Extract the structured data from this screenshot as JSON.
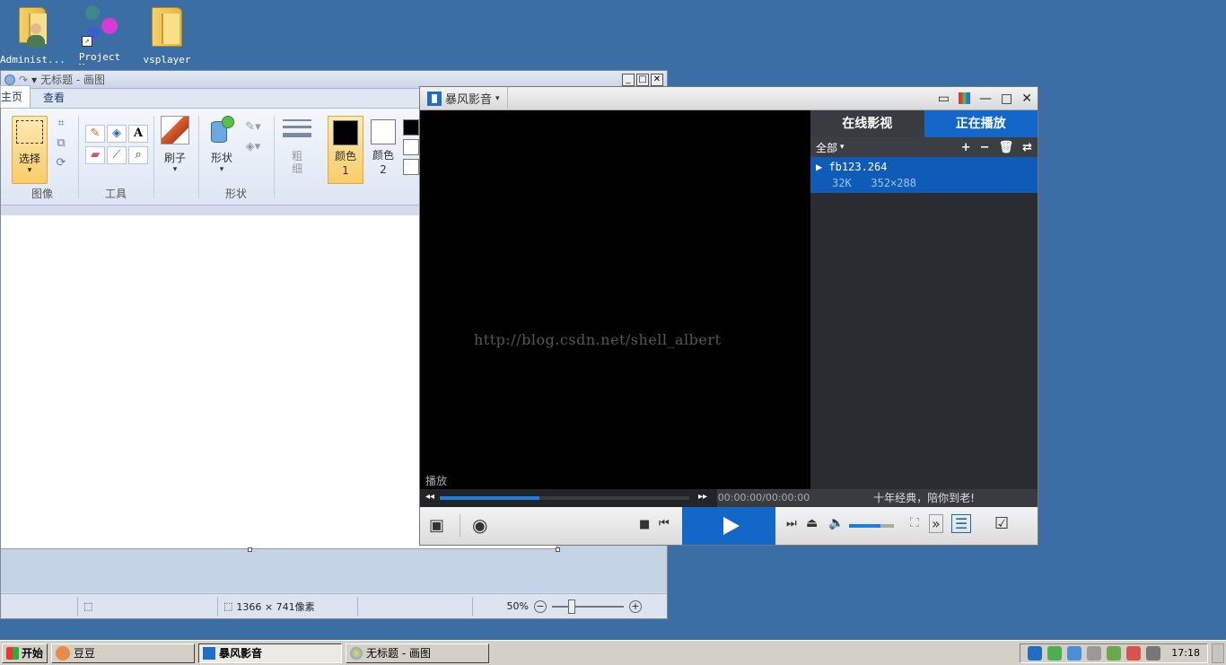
{
  "desktop": {
    "icons": [
      {
        "label": "Administ..."
      },
      {
        "label": "Project Manager"
      },
      {
        "label": "vsplayer"
      }
    ]
  },
  "paint": {
    "title": "无标题 - 画图",
    "tabs": [
      {
        "label": "主页"
      },
      {
        "label": "查看"
      }
    ],
    "select_label": "选择",
    "groups": {
      "image": "图像",
      "tools": "工具",
      "shapes": "形状"
    },
    "brush_label": "刷子",
    "shape_label": "形状",
    "thickness_label": "粗细",
    "color1_label": "颜色 1",
    "color2_label": "颜色 2",
    "colors": {
      "color1": "#000000",
      "color2": "#ffffff"
    },
    "status": {
      "canvas_size": "1366 × 741像素",
      "zoom": "50%"
    },
    "tool_icons": [
      "pencil-icon",
      "fill-icon",
      "text-icon",
      "eraser-icon",
      "color-picker-icon",
      "magnifier-icon"
    ]
  },
  "player": {
    "app_name": "暴风影音",
    "watermark": "http://blog.csdn.net/shell_albert",
    "status_text": "播放",
    "time": "00:00:00/00:00:00",
    "progress": 0.4,
    "volume": 0.7,
    "side_tabs": [
      {
        "label": "在线影视"
      },
      {
        "label": "正在播放"
      }
    ],
    "filter_label": "全部",
    "playlist": [
      {
        "name": "fb123.264",
        "size": "32K",
        "resolution": "352×288"
      }
    ],
    "slogan": "十年经典，陪你到老!",
    "accent_color": "#1267c8"
  },
  "taskbar": {
    "start_label": "开始",
    "tasks": [
      {
        "label": "豆豆"
      },
      {
        "label": "暴风影音"
      },
      {
        "label": "无标题 - 画图"
      }
    ],
    "clock": "17:18"
  }
}
